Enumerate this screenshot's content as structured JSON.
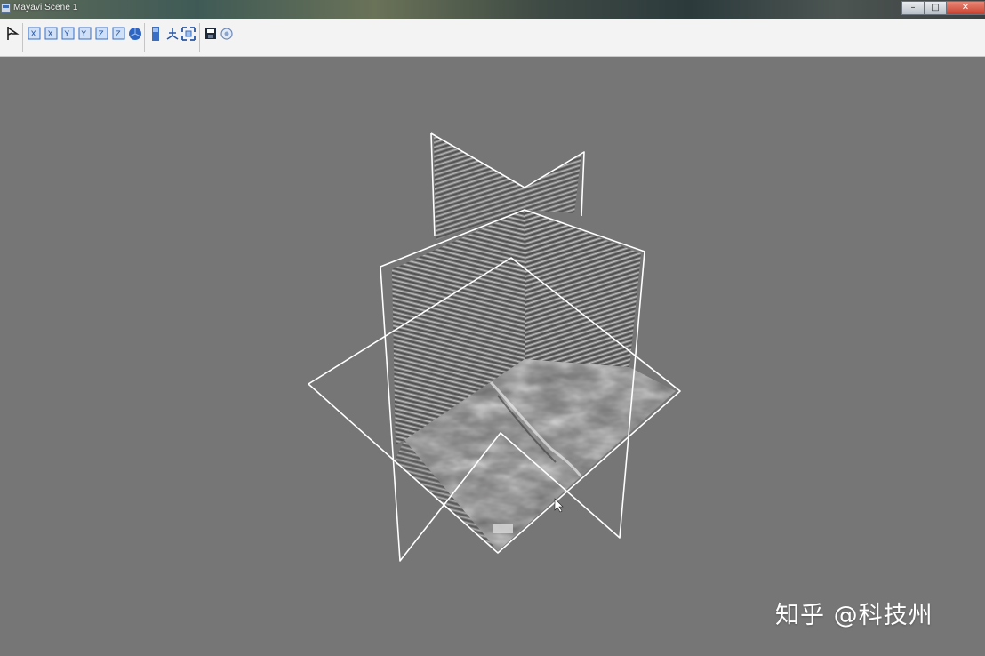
{
  "window": {
    "title": "Mayavi Scene 1",
    "controls": {
      "minimize": "–",
      "maximize": "□",
      "close": "✕"
    }
  },
  "toolbar": {
    "buttons": [
      {
        "name": "pick-icon"
      },
      {
        "name": "view-x-plus-icon",
        "glyph": "X"
      },
      {
        "name": "view-x-minus-icon",
        "glyph": "X"
      },
      {
        "name": "view-y-plus-icon",
        "glyph": "Y"
      },
      {
        "name": "view-y-minus-icon",
        "glyph": "Y"
      },
      {
        "name": "view-z-plus-icon",
        "glyph": "Z"
      },
      {
        "name": "view-z-minus-icon",
        "glyph": "Z"
      },
      {
        "name": "isometric-view-icon"
      },
      {
        "name": "parallel-projection-icon"
      },
      {
        "name": "show-axes-icon"
      },
      {
        "name": "full-screen-icon"
      },
      {
        "name": "save-icon"
      },
      {
        "name": "settings-icon"
      }
    ]
  },
  "watermark": {
    "text": "知乎 @科技州"
  },
  "colors": {
    "scene_background": "#777676",
    "outline": "#ffffff",
    "toolbar_icon": "#3a6fc4"
  }
}
